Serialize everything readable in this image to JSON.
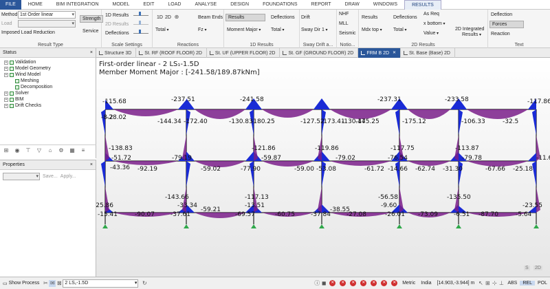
{
  "menu": [
    "FILE",
    "HOME",
    "BIM INTEGRATION",
    "MODEL",
    "EDIT",
    "LOAD",
    "ANALYSE",
    "DESIGN",
    "FOUNDATIONS",
    "REPORT",
    "DRAW",
    "WINDOWS",
    "RESULTS"
  ],
  "ribbon": {
    "result_type": {
      "title": "Result Type",
      "method_label": "Method",
      "method_value": "1st Order linear",
      "load_label": "Load",
      "imposed_label": "Imposed Load Reduction",
      "strength": "Strength",
      "service": "Service"
    },
    "scale": {
      "title": "Scale Settings",
      "results_1d": "1D Results",
      "results_2d": "2D Results",
      "deflections": "Deflections"
    },
    "reactions": {
      "title": "Reactions",
      "btn_1d": "1D",
      "btn_2d": "2D",
      "total": "Total",
      "beam_ends": "Beam Ends",
      "fz": "Fz"
    },
    "results_1d": {
      "title": "1D Results",
      "results": "Results",
      "moment_major": "Moment Major",
      "deflections": "Deflections",
      "total": "Total"
    },
    "sway": {
      "title": "Sway Drift a...",
      "drift": "Drift",
      "sway_dir": "Sway Dir 1"
    },
    "notional": {
      "title": "Notio...",
      "nhf": "NHF",
      "mll": "MLL",
      "seismic": "Seismic"
    },
    "results_2d": {
      "title": "2D Results",
      "results": "Results",
      "mdx_top": "Mdx top",
      "deflections": "Deflections",
      "total": "Total",
      "as_req": "As Req",
      "x_bottom": "x bottom",
      "value": "Value",
      "integrated": "2D Integrated",
      "integrated_results": "Results"
    },
    "text": {
      "title": "Text",
      "deflection": "Deflection",
      "forces": "Forces",
      "reaction": "Reaction"
    }
  },
  "tabs": [
    {
      "label": "Structure 3D",
      "active": false
    },
    {
      "label": "St. RF (ROOF FLOOR) 2D",
      "active": false
    },
    {
      "label": "St. UF (UPPER FLOOR) 2D",
      "active": false
    },
    {
      "label": "St. GF (GROUND FLOOR) 2D",
      "active": false
    },
    {
      "label": "FRM B 2D",
      "active": true
    },
    {
      "label": "St. Base (Base) 2D",
      "active": false
    }
  ],
  "status_panel": {
    "title": "Status",
    "items": [
      {
        "label": "Validation",
        "level": 1,
        "expander": true
      },
      {
        "label": "Model Geometry",
        "level": 1,
        "expander": true
      },
      {
        "label": "Wind Model",
        "level": 1,
        "expander": true
      },
      {
        "label": "Meshing",
        "level": 2,
        "expander": false
      },
      {
        "label": "Decomposition",
        "level": 2,
        "expander": false
      },
      {
        "label": "Solver",
        "level": 1,
        "expander": true
      },
      {
        "label": "BIM",
        "level": 1,
        "expander": true
      },
      {
        "label": "Drift Checks",
        "level": 1,
        "expander": true
      }
    ]
  },
  "props_panel": {
    "title": "Properties",
    "save": "Save...",
    "apply": "Apply..."
  },
  "canvas": {
    "line1": "First-order linear - 2 LS₁-1.5D",
    "line2": "Member Moment Major : [-241.58/189.87kNm]",
    "view_label": "2D",
    "corner_s": "S"
  },
  "diagram_labels": {
    "roof": [
      "-115.68",
      "-237.51",
      "-241.58",
      "-237.31",
      "-233.58",
      "-117.86",
      "-144.34",
      "-172.40",
      "-130.83",
      "-180.25",
      "-127.52",
      "-173.41",
      "-130.44",
      "-175.25",
      "-175.12",
      "-106.33",
      "-32.5",
      "-8.2",
      "-28.02"
    ],
    "upper": [
      "-138.83",
      "-121.86",
      "-119.86",
      "-117.75",
      "-113.87",
      "-51.72",
      "-92.19",
      "-79.19",
      "-59.02",
      "-77.90",
      "-59.87",
      "-59.00",
      "-53.08",
      "-79.02",
      "-61.72",
      "-14.66",
      "-62.74",
      "-31.30",
      "-79.78",
      "-67.66",
      "-25.18",
      "-11.6",
      "-43.36",
      "-76.54"
    ],
    "ground": [
      "-143.66",
      "-117.13",
      "-56.58",
      "-135.50",
      "-25.86",
      "-15.41",
      "-90.07",
      "-37.61",
      "-59.21",
      "-69.57",
      "-60.75",
      "-37.84",
      "-38.55",
      "-27.08",
      "-26.01",
      "-73.09",
      "-6.51",
      "-87.70",
      "-5.64",
      "-33.34",
      "-13.51",
      "-9.60",
      "-23.55"
    ]
  },
  "statusbar": {
    "show_process": "Show Process",
    "combo": "2 LS₁-1.5D",
    "metric": "Metric",
    "region": "India",
    "coords": "[14.903,-3.944] m",
    "abs": "ABS",
    "rel": "REL",
    "pol": "POL"
  },
  "colors": {
    "accent": "#2b579a",
    "diagram_fill": "#7a1f8a",
    "diagram_blue": "#1a2bd6",
    "support": "#2fa84a"
  }
}
